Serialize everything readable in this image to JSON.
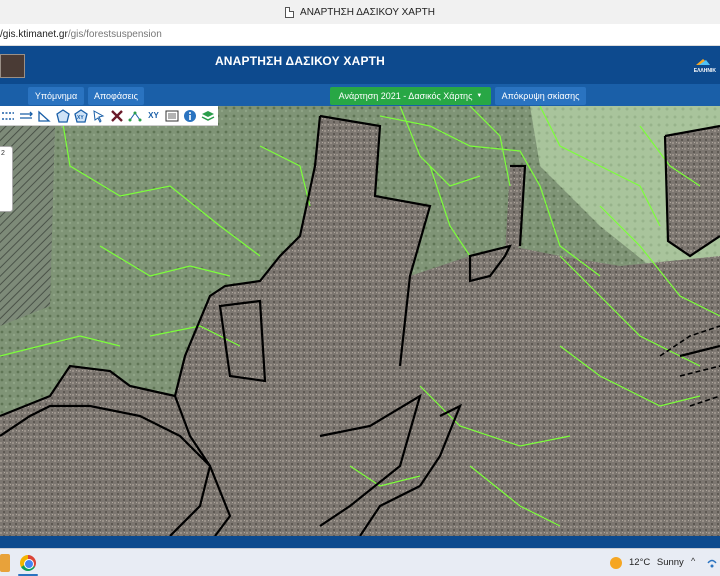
{
  "browser": {
    "tab_title": "ΑΝΑΡΤΗΣΗ ΔΑΣΙΚΟΥ ΧΑΡΤΗ",
    "url_host": "/gis.ktimanet.gr",
    "url_path": "/gis/forestsuspension"
  },
  "header": {
    "title": "ΑΝΑΡΤΗΣΗ ΔΑΣΙΚΟΥ ΧΑΡΤΗ",
    "right_logo_text": "ΕΛΛΗΝΙΚ",
    "brand_color": "#0d4a8e"
  },
  "nav": {
    "legend": "Υπόμνημα",
    "decisions": "Αποφάσεις",
    "layer_select": "Ανάρτηση 2021 - Δασικός Χάρτης",
    "hide_shading": "Απόκρυψη σκίασης"
  },
  "toolbar": {
    "tools": [
      "pan-icon",
      "measure-line-icon",
      "measure-angle-icon",
      "polygon-icon",
      "xy-polygon-icon",
      "select-arrow-icon",
      "clear-icon",
      "connect-points-icon",
      "xy-coordinates-icon",
      "print-icon",
      "info-icon",
      "layers-icon"
    ],
    "xy_label": "XY"
  },
  "side_panel": {
    "label": "2"
  },
  "taskbar": {
    "weather_temp": "12°C",
    "weather_desc": "Sunny",
    "chevron": "^"
  },
  "colors": {
    "forest_outline": "#7cff3a",
    "boundary": "#000000",
    "nav_green": "#28a745"
  }
}
